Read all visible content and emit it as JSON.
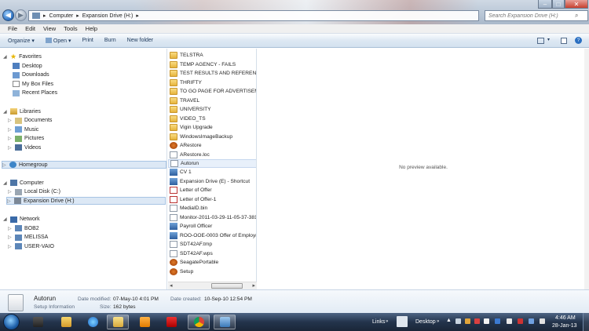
{
  "window": {
    "back_label": "◀",
    "forward_label": "▶",
    "address": [
      "Computer",
      "Expansion Drive (H:)"
    ],
    "address_sep": "▸",
    "search_placeholder": "Search Expansion Drive (H:)",
    "controls": [
      "–",
      "□",
      "✕"
    ]
  },
  "menu": [
    "File",
    "Edit",
    "View",
    "Tools",
    "Help"
  ],
  "command_bar": {
    "organize": "Organize ▾",
    "open": "Open ▾",
    "print": "Print",
    "burn": "Burn",
    "new_folder": "New folder",
    "view_icon": "view-options-icon",
    "preview_pane_icon": "preview-pane-icon",
    "help_icon": "help-icon"
  },
  "nav": {
    "favorites": "Favorites",
    "favorites_items": [
      "Desktop",
      "Downloads",
      "My Box Files",
      "Recent Places"
    ],
    "libraries": "Libraries",
    "libraries_items": [
      "Documents",
      "Music",
      "Pictures",
      "Videos"
    ],
    "homegroup": "Homegroup",
    "computer": "Computer",
    "computer_items": [
      "Local Disk (C:)",
      "Expansion Drive (H:)"
    ],
    "network": "Network",
    "network_items": [
      "BOB2",
      "MELISSA",
      "USER-VAIO"
    ]
  },
  "files": [
    {
      "name": "TELSTRA",
      "icon": "folder"
    },
    {
      "name": "TEMP AGENCY - FAILS",
      "icon": "folder"
    },
    {
      "name": "TEST RESULTS AND REFERENCES",
      "icon": "folder"
    },
    {
      "name": "THRIFTY",
      "icon": "folder"
    },
    {
      "name": "TO GO PAGE FOR ADVERTISEMEN",
      "icon": "folder"
    },
    {
      "name": "TRAVEL",
      "icon": "folder"
    },
    {
      "name": "UNIVERSITY",
      "icon": "folder"
    },
    {
      "name": "VIDEO_TS",
      "icon": "folder"
    },
    {
      "name": "Vigin Upgrade",
      "icon": "folder"
    },
    {
      "name": "WindowsImageBackup",
      "icon": "folder"
    },
    {
      "name": "ARestore",
      "icon": "exe"
    },
    {
      "name": "ARestore.loc",
      "icon": "doc"
    },
    {
      "name": "Autorun",
      "icon": "doc"
    },
    {
      "name": "CV 1",
      "icon": "lnk"
    },
    {
      "name": "Expansion Drive (E) - Shortcut",
      "icon": "lnk"
    },
    {
      "name": "Letter of Offer",
      "icon": "pdf"
    },
    {
      "name": "Letter of Offer-1",
      "icon": "pdf"
    },
    {
      "name": "MediaID.bin",
      "icon": "doc"
    },
    {
      "name": "Monitor-2011-03-29-11-05-37-381",
      "icon": "doc"
    },
    {
      "name": "Payroll Officer",
      "icon": "lnk"
    },
    {
      "name": "ROO-OOE-0003 Offer of Employm",
      "icon": "lnk"
    },
    {
      "name": "SDT42AF.tmp",
      "icon": "doc"
    },
    {
      "name": "SDT42AF.wps",
      "icon": "doc"
    },
    {
      "name": "SeagatePortable",
      "icon": "exe"
    },
    {
      "name": "Setup",
      "icon": "exe"
    }
  ],
  "selected_file_index": 12,
  "preview": {
    "message": "No preview available."
  },
  "details": {
    "name": "Autorun",
    "type": "Setup Information",
    "modified_label": "Date modified:",
    "modified_value": "07-May-10 4:01 PM",
    "size_label": "Size:",
    "size_value": "162 bytes",
    "created_label": "Date created:",
    "created_value": "10-Sep-10 12:54 PM"
  },
  "taskbar": {
    "links": "Links",
    "desktop": "Desktop",
    "time": "4:46 AM",
    "date": "28-Jan-13",
    "apps": [
      "media-player-icon",
      "ie-icon",
      "explorer-icon",
      "media-icon",
      "app-icon",
      "chrome-icon",
      "remote-icon"
    ]
  },
  "colors": {
    "accent": "#1e395b",
    "selection": "#dce8f5",
    "taskbar": "#23344c",
    "folder": "#e6b43c"
  }
}
